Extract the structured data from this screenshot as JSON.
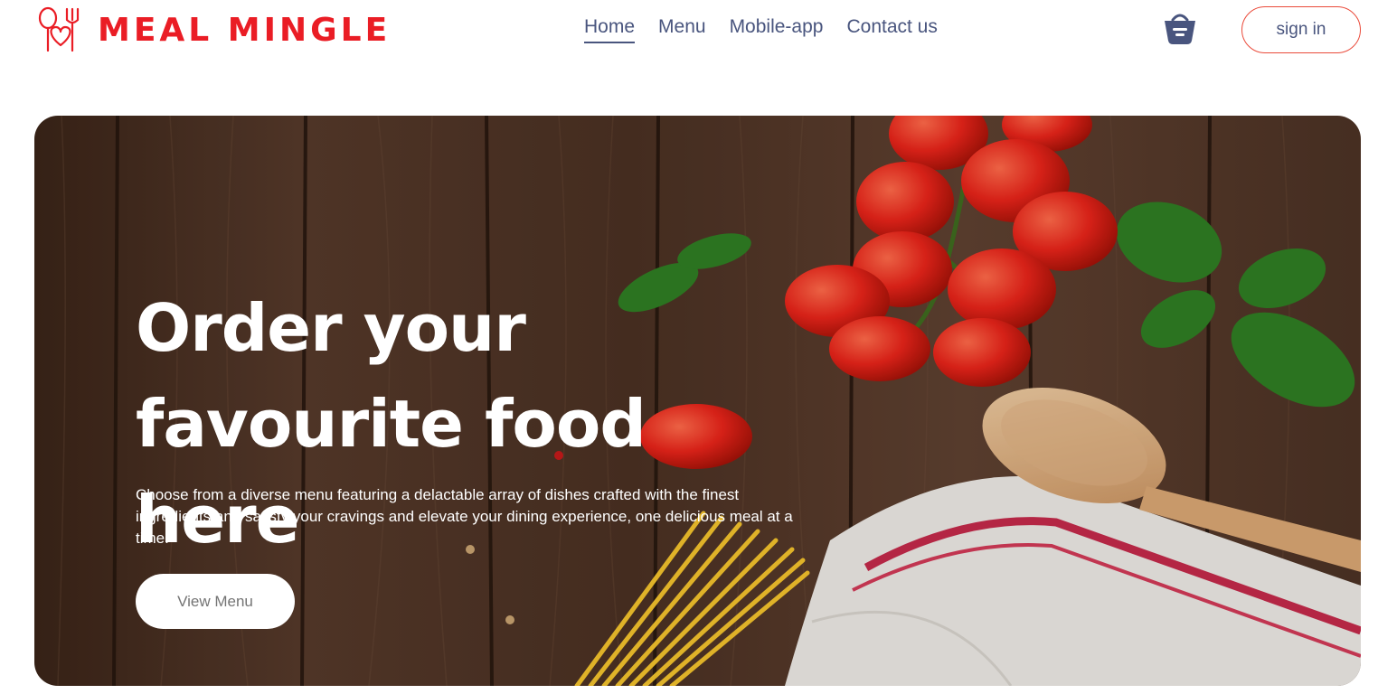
{
  "brand": {
    "name": "MEAL MINGLE",
    "accent_color": "#ea1d25",
    "icon": "fork-spoon-heart-icon"
  },
  "nav": {
    "items": [
      {
        "label": "Home",
        "active": true
      },
      {
        "label": "Menu",
        "active": false
      },
      {
        "label": "Mobile-app",
        "active": false
      },
      {
        "label": "Contact us",
        "active": false
      }
    ],
    "text_color": "#49557e"
  },
  "header": {
    "basket_icon": "basket-icon",
    "sign_in_label": "sign in",
    "sign_in_border_color": "#ea4a3a"
  },
  "hero": {
    "title_line1": "Order your",
    "title_line2": "favourite food here",
    "description": "Choose from a diverse menu featuring a delactable array of dishes crafted with the finest ingredients and satisfy your cravings and elevate your dining experience, one delicious meal at a time.",
    "button_label": "View Menu",
    "background": "wood-table-tomatoes-basil-pasta-spoon-towel"
  }
}
